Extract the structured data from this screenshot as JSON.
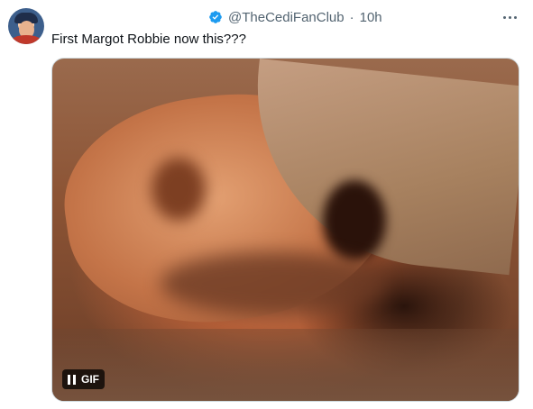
{
  "tweet": {
    "handle": "@TheCediFanClub",
    "separator": "·",
    "time": "10h",
    "text": "First Margot Robbie now this???"
  },
  "media": {
    "badge_label": "GIF",
    "pause_icon": "pause-icon"
  },
  "icons": {
    "verified": "verified-badge-icon",
    "more": "more-options-icon",
    "accent": "#1d9bf0"
  }
}
